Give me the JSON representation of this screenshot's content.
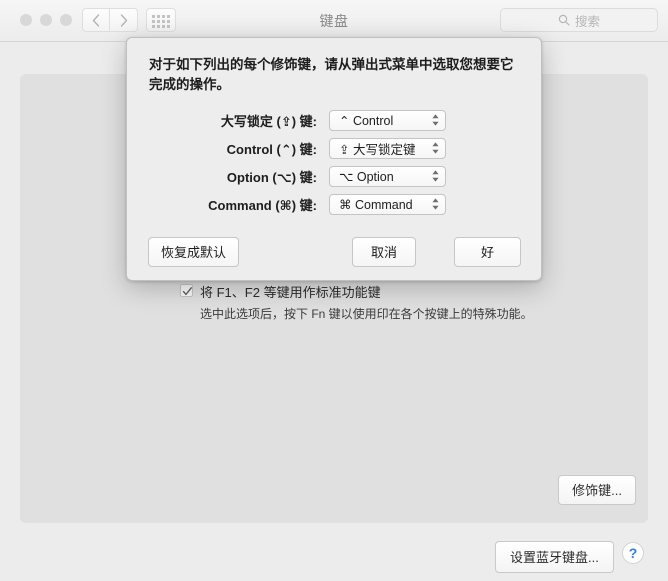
{
  "window": {
    "title": "键盘",
    "traffic_lights": [
      "close",
      "minimize",
      "maximize"
    ],
    "nav": {
      "back": "back-arrow",
      "forward": "forward-arrow"
    },
    "show_all": "show-all-grid",
    "search": {
      "placeholder": "搜索",
      "value": ""
    }
  },
  "panel": {
    "fn_checkbox": {
      "checked": true,
      "label": "将 F1、F2 等键用作标准功能键",
      "sublabel": "选中此选项后，按下 Fn 键以使用印在各个按键上的特殊功能。"
    },
    "modifier_button": "修饰键..."
  },
  "bottom": {
    "bluetooth_button": "设置蓝牙键盘...",
    "help_button": "?"
  },
  "dialog": {
    "description": "对于如下列出的每个修饰键，请从弹出式菜单中选取您想要它完成的操作。",
    "rows": [
      {
        "label": "大写锁定 (⇪) 键:",
        "value": "⌃ Control"
      },
      {
        "label": "Control (⌃) 键:",
        "value": "⇪ 大写锁定键"
      },
      {
        "label": "Option (⌥) 键:",
        "value": "⌥ Option"
      },
      {
        "label": "Command (⌘) 键:",
        "value": "⌘ Command"
      }
    ],
    "buttons": {
      "restore": "恢复成默认",
      "cancel": "取消",
      "ok": "好"
    }
  },
  "colors": {
    "window_bg": "#ececec",
    "panel_bg": "#e0e0e0",
    "dialog_bg": "#ededed",
    "accent_blue": "#2f7fe8",
    "text": "#1d1d1d",
    "title_text": "#8a8a8a"
  }
}
